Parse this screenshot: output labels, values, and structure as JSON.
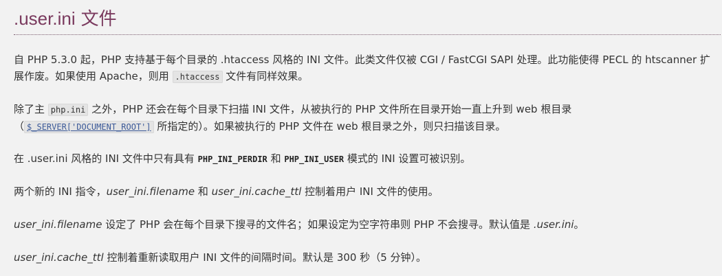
{
  "header": {
    "title_code": ".user.ini",
    "title_text": "文件"
  },
  "p1": {
    "line1": "自 PHP 5.3.0 起，PHP 支持基于每个目录的 .htaccess 风格的 INI 文件。此类文件仅被 CGI / FastCGI SAPI 处理。此功能使得 PECL 的 htscanner 扩",
    "line2_a": "展作废。如果使用 Apache，则用 ",
    "line2_code": ".htaccess",
    "line2_b": " 文件有同样效果。"
  },
  "p2": {
    "line1_a": "除了主 ",
    "line1_code": "php.ini",
    "line1_b": " 之外，PHP 还会在每个目录下扫描 INI 文件，从被执行的 PHP 文件所在目录开始一直上升到 web 根目录",
    "line2_a": "（",
    "line2_code": "$_SERVER['DOCUMENT_ROOT']",
    "line2_b": " 所指定的）。如果被执行的 PHP 文件在 web 根目录之外，则只扫描该目录。"
  },
  "p3": {
    "a": "在 .user.ini 风格的 INI 文件中只有具有 ",
    "strong1": "PHP_INI_PERDIR",
    "b": " 和 ",
    "strong2": "PHP_INI_USER",
    "c": " 模式的 INI 设置可被识别。"
  },
  "p4": {
    "a": "两个新的 INI 指令，",
    "em1": "user_ini.filename",
    "b": " 和 ",
    "em2": "user_ini.cache_ttl",
    "c": " 控制着用户 INI 文件的使用。"
  },
  "p5": {
    "em1": "user_ini.filename",
    "a": " 设定了 PHP 会在每个目录下搜寻的文件名；如果设定为空字符串则 PHP 不会搜寻。默认值是 ",
    "em2": ".user.ini",
    "b": "。"
  },
  "p6": {
    "em1": "user_ini.cache_ttl",
    "a": " 控制着重新读取用户 INI 文件的间隔时间。默认是 300 秒（5 分钟）。"
  }
}
